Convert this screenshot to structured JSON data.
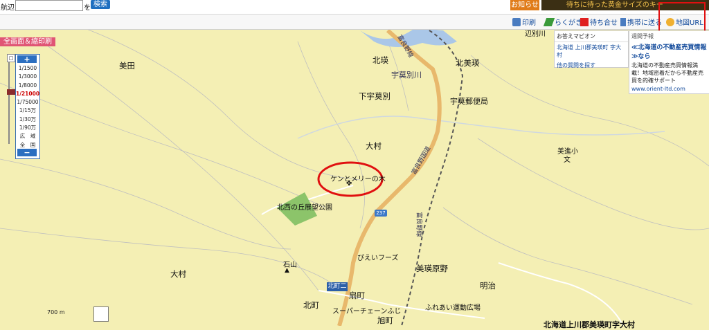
{
  "topbar": {
    "search_label": "航辺で",
    "search_value": "",
    "search_suffix": "を",
    "search_button": "検索",
    "notice_button": "お知らせ",
    "ad_text": "待ちに待った黄金サイズのキー"
  },
  "toolbar": {
    "print": "印刷",
    "doodle": "らくがき",
    "meeting": "待ち合せ",
    "mobile": "携帯に送る",
    "map_url": "地図URL"
  },
  "full_screen_button": "全画面＆縮印刷",
  "zoom": {
    "plus": "+",
    "minus": "−",
    "levels": [
      "1/1500",
      "1/3000",
      "1/8000",
      "1/21000",
      "1/75000",
      "1/15万",
      "1/30万",
      "1/90万",
      "広　域",
      "全　国"
    ],
    "selected": "1/21000"
  },
  "places": {
    "mita": "美田",
    "kitaei": "北瑛",
    "uebetsugawa": "宇莫別川",
    "shimouebetsu": "下宇莫別",
    "oomura1": "大村",
    "oomura2": "大村",
    "kitabieri": "北美瑛",
    "post_office": "宇莫郵便局",
    "bishin_school": "美進小",
    "ken_mary": "ケンとメリーの木",
    "park": "北西の丘展望公園",
    "ishiyama": "石山",
    "piei_foods": "ぴえいフーズ",
    "biei_harano": "美瑛原野",
    "meiji": "明治",
    "kitamachi": "北町",
    "ogimachi": "扇町",
    "asahimachi": "旭町",
    "supermarket": "スーパーチェーンふじ",
    "fureai": "ふれあい運動広場",
    "furano_line1": "富良野線",
    "furano_line2": "富良野国道",
    "furano_line3": "富良野線",
    "route": "237",
    "rail_station": "北町二",
    "henbetsu": "辺別川"
  },
  "qa": {
    "title": "お答えマピオン",
    "location": "北海道 上川郡美瑛町 字大村",
    "link": "他の質問を探す"
  },
  "weather": {
    "forecast": "週間予報",
    "ad_title": "≪北海道の不動産売買情報≫なら",
    "ad_body": "北海道の不動産売買情報満載！地域密着だから不動産売買を的確サポート",
    "ad_url": "www.orient-ltd.com"
  },
  "scale": {
    "label": "700 m"
  },
  "address": "北海道上川郡美瑛町字大村",
  "colors": {
    "map_bg": "#f4efb4",
    "road_major": "#e8b86c",
    "annotation_circle": "#e01010",
    "accent_blue": "#1f6fc0"
  }
}
